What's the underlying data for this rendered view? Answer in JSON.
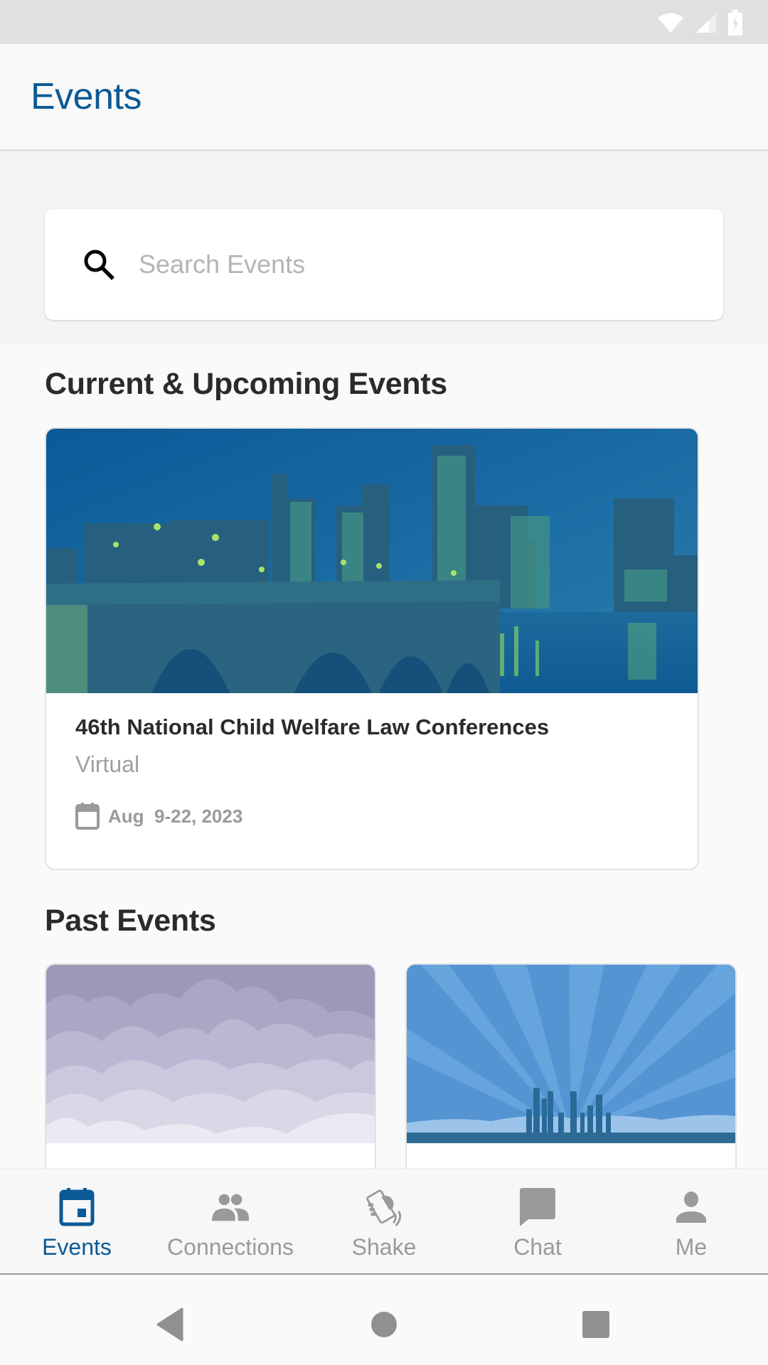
{
  "status_bar": {
    "icons": [
      "wifi-icon",
      "cell-signal-icon",
      "battery-charging-icon"
    ]
  },
  "header": {
    "title": "Events"
  },
  "search": {
    "placeholder": "Search Events",
    "value": "",
    "icon": "search-icon"
  },
  "sections": {
    "upcoming": {
      "title": "Current & Upcoming Events",
      "events": [
        {
          "name": "46th National Child Welfare Law Conferences",
          "location": "Virtual",
          "date": "Aug  9-22, 2023",
          "date_icon": "calendar-icon",
          "image": "city-skyline-bridge-night"
        }
      ]
    },
    "past": {
      "title": "Past Events",
      "events": [
        {
          "image": "purple-clouds"
        },
        {
          "image": "blue-sunburst-skyline"
        }
      ]
    }
  },
  "bottom_nav": {
    "active": "Events",
    "active_color": "#0b5a96",
    "inactive_color": "#9a9a9a",
    "items": [
      {
        "label": "Events",
        "icon": "calendar-icon"
      },
      {
        "label": "Connections",
        "icon": "people-icon"
      },
      {
        "label": "Shake",
        "icon": "shake-phone-icon"
      },
      {
        "label": "Chat",
        "icon": "chat-bubble-icon"
      },
      {
        "label": "Me",
        "icon": "person-icon"
      }
    ]
  },
  "system_nav": {
    "buttons": [
      "back",
      "home",
      "recents"
    ]
  }
}
